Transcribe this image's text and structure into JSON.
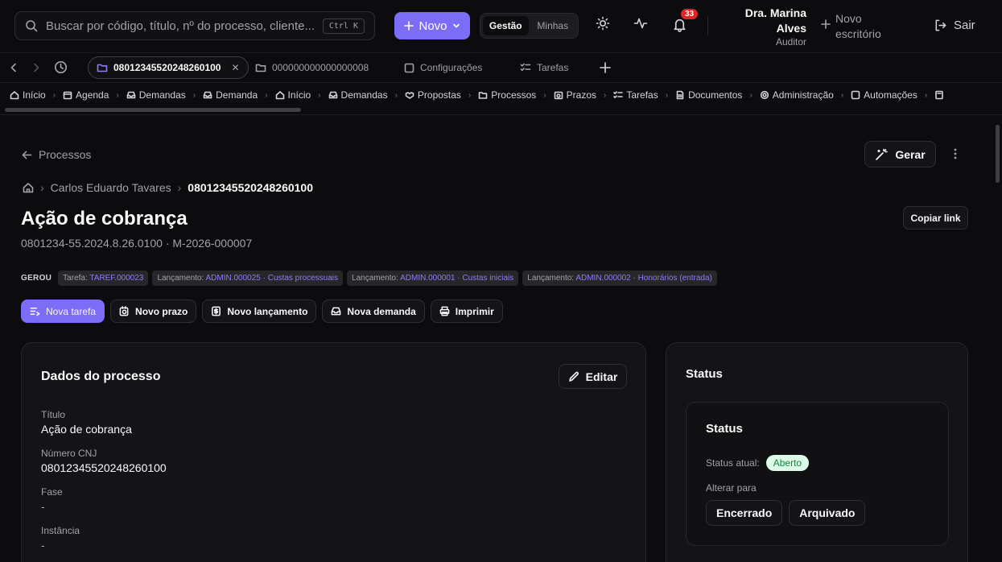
{
  "topbar": {
    "search_placeholder": "Buscar por código, título, nº do processo, cliente...",
    "search_shortcut": "Ctrl K",
    "novo_label": "Novo",
    "segment": [
      "Gestão",
      "Minhas"
    ],
    "notifications_count": "33",
    "user_name_line1": "Dra. Marina",
    "user_name_line2": "Alves",
    "user_role": "Auditor",
    "novo_escritorio_line1": "Novo",
    "novo_escritorio_line2": "escritório",
    "sair_label": "Sair"
  },
  "tabs": [
    {
      "label": "08012345520248260100",
      "icon": "folder-icon",
      "active": true
    },
    {
      "label": "000000000000000008",
      "icon": "folder-icon",
      "active": false
    },
    {
      "label": "Configurações",
      "icon": "square-icon",
      "active": false
    },
    {
      "label": "Tarefas",
      "icon": "checklist-icon",
      "active": false
    }
  ],
  "navbar": [
    "Início",
    "Agenda",
    "Demandas",
    "Demanda",
    "Início",
    "Demandas",
    "Propostas",
    "Processos",
    "Prazos",
    "Tarefas",
    "Documentos",
    "Administração",
    "Automações"
  ],
  "page": {
    "back_label": "Processos",
    "gerar_label": "Gerar",
    "breadcrumb": [
      "Carlos Eduardo Tavares",
      "08012345520248260100"
    ],
    "title": "Ação de cobrança",
    "subtitle": "0801234-55.2024.8.26.0100 · M-2026-000007",
    "copiar_label": "Copiar link",
    "gerou_label": "GEROU",
    "gerou_chips": [
      {
        "prefix": "Tarefa:",
        "link": "TAREF.000023"
      },
      {
        "prefix": "Lançamento:",
        "link": "ADMIN.000025 · Custas processuais"
      },
      {
        "prefix": "Lançamento:",
        "link": "ADMIN.000001 · Custas iniciais"
      },
      {
        "prefix": "Lançamento:",
        "link": "ADMIN.000002 · Honorários (entrada)"
      }
    ],
    "actions": [
      "Nova tarefa",
      "Novo prazo",
      "Novo lançamento",
      "Nova demanda",
      "Imprimir"
    ]
  },
  "dados": {
    "title": "Dados do processo",
    "editar_label": "Editar",
    "fields": [
      {
        "label": "Título",
        "value": "Ação de cobrança"
      },
      {
        "label": "Número CNJ",
        "value": "08012345520248260100"
      },
      {
        "label": "Fase",
        "value": "-"
      },
      {
        "label": "Instância",
        "value": "-"
      }
    ]
  },
  "status": {
    "card_title": "Status",
    "inner_title": "Status",
    "current_label": "Status atual:",
    "current_value": "Aberto",
    "alterar_label": "Alterar para",
    "options": [
      "Encerrado",
      "Arquivado"
    ]
  }
}
